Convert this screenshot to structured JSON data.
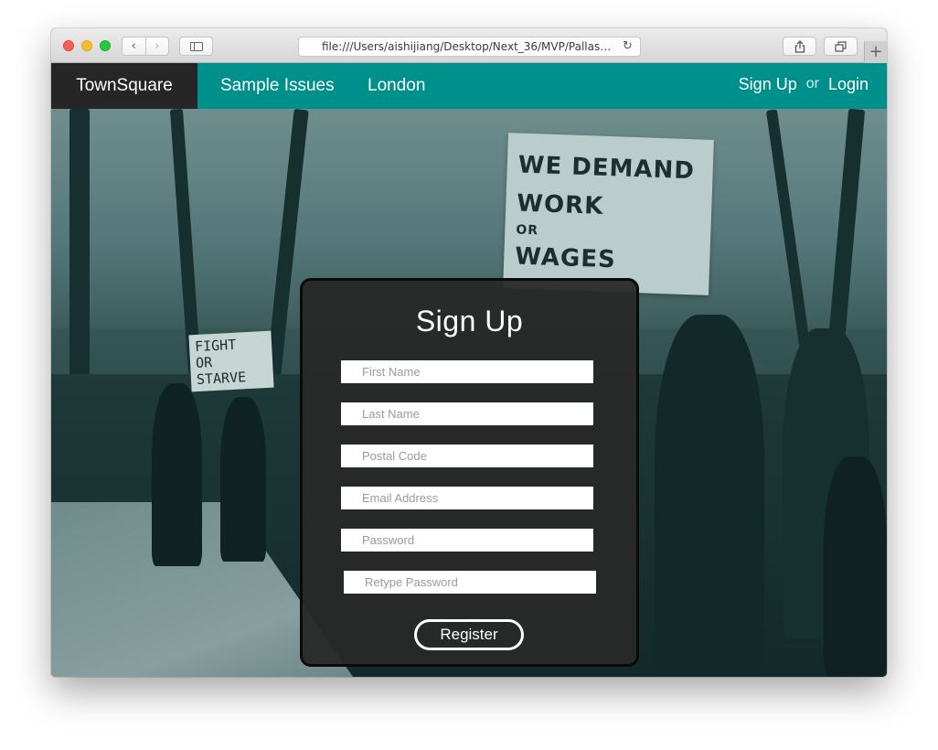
{
  "browser": {
    "url": "file:///Users/aishijiang/Desktop/Next_36/MVP/PallasMain..."
  },
  "nav": {
    "brand": "TownSquare",
    "links": [
      "Sample Issues",
      "London"
    ],
    "signup": "Sign Up",
    "or": "or",
    "login": "Login"
  },
  "hero": {
    "banner_text": [
      "WE DEMAND",
      "WORK",
      "OR",
      "WAGES"
    ],
    "sign_text": [
      "FIGHT",
      "OR",
      "STARVE"
    ]
  },
  "form": {
    "title": "Sign Up",
    "fields": [
      {
        "placeholder": "First Name",
        "value": ""
      },
      {
        "placeholder": "Last Name",
        "value": ""
      },
      {
        "placeholder": "Postal Code",
        "value": ""
      },
      {
        "placeholder": "Email Address",
        "value": ""
      },
      {
        "placeholder": "Password",
        "value": ""
      },
      {
        "placeholder": "Retype Password",
        "value": ""
      }
    ],
    "submit": "Register"
  },
  "colors": {
    "nav_teal": "#00908c",
    "brand_dark": "#262626",
    "modal_bg": "#282828"
  }
}
